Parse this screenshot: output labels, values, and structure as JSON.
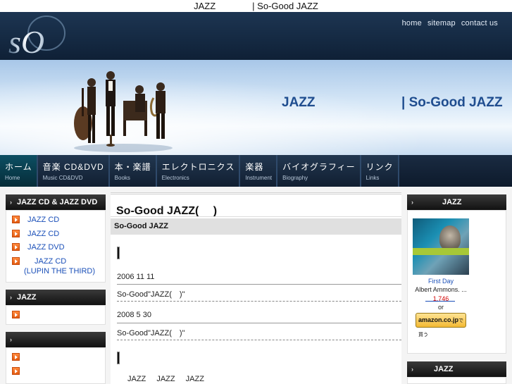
{
  "page_title": "JAZZ　　　　|  So-Good JAZZ",
  "header": {
    "logo_text": "sO",
    "nav": [
      "home",
      "sitemap",
      "contact us"
    ]
  },
  "banner": {
    "text_left": "JAZZ",
    "text_right": "| So-Good JAZZ"
  },
  "main_nav": [
    {
      "jp": "ホーム",
      "en": "Home",
      "active": true
    },
    {
      "jp": "音楽 CD&DVD",
      "en": "Music CD&DVD"
    },
    {
      "jp": "本・楽譜",
      "en": "Books"
    },
    {
      "jp": "エレクトロニクス",
      "en": "Electronics"
    },
    {
      "jp": "楽器",
      "en": "Instrument"
    },
    {
      "jp": "バイオグラフィー",
      "en": "Biography"
    },
    {
      "jp": "リンク",
      "en": "Links"
    }
  ],
  "left_sidebar": {
    "box1": {
      "title": "JAZZ CD & JAZZ DVD",
      "items": [
        "JAZZ CD",
        "JAZZ CD",
        "JAZZ DVD",
        "JAZZ CD",
        "(LUPIN THE THIRD)"
      ]
    },
    "box2": {
      "title": "JAZZ"
    },
    "box3": {
      "title": ""
    }
  },
  "center": {
    "title": "So-Good JAZZ(　 )",
    "subtitle": "So-Good JAZZ",
    "entries": [
      {
        "date": "2006 11 11",
        "text": "So-Good\"JAZZ(　)\""
      },
      {
        "date": "2008 5 30",
        "text": "So-Good\"JAZZ(　)\""
      }
    ],
    "bottom_text": "JAZZ   JAZZ     JAZZ"
  },
  "right_sidebar": {
    "box1": {
      "title": "JAZZ",
      "product": {
        "title": "First Day",
        "artist": "Albert Ammons. ...",
        "price": "1,746",
        "or": "or",
        "button_label": "amazon.co.jp",
        "button_sub": "で買う"
      }
    },
    "box2": {
      "title": "JAZZ"
    }
  },
  "colors": {
    "header_bg": "#152a43",
    "nav_active": "#0c4f63",
    "link": "#1a4fb8",
    "banner_text": "#1f4d8f",
    "price": "#d00000",
    "bullet": "#e25a10"
  },
  "icons": [
    "orange-arrow-bullet-icon",
    "white-arrow-icon"
  ]
}
